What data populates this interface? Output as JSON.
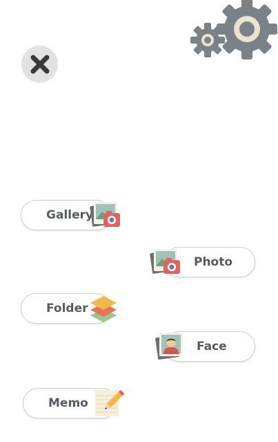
{
  "settings": {
    "icon": "gears-icon"
  },
  "close": {
    "icon": "close-icon"
  },
  "menu": {
    "gallery": {
      "label": "Gallery",
      "icon": "gallery-photo-icon"
    },
    "photo": {
      "label": "Photo",
      "icon": "camera-photo-icon"
    },
    "folder": {
      "label": "Folder",
      "icon": "layers-icon"
    },
    "face": {
      "label": "Face",
      "icon": "portrait-icon"
    },
    "memo": {
      "label": "Memo",
      "icon": "memo-pencil-icon"
    }
  },
  "colors": {
    "gear": "#7b8187",
    "gear_hub": "#e9e2cf",
    "close_bg": "#e2e2e2",
    "close_x": "#3a3a3a",
    "pill_text": "#555b60"
  }
}
